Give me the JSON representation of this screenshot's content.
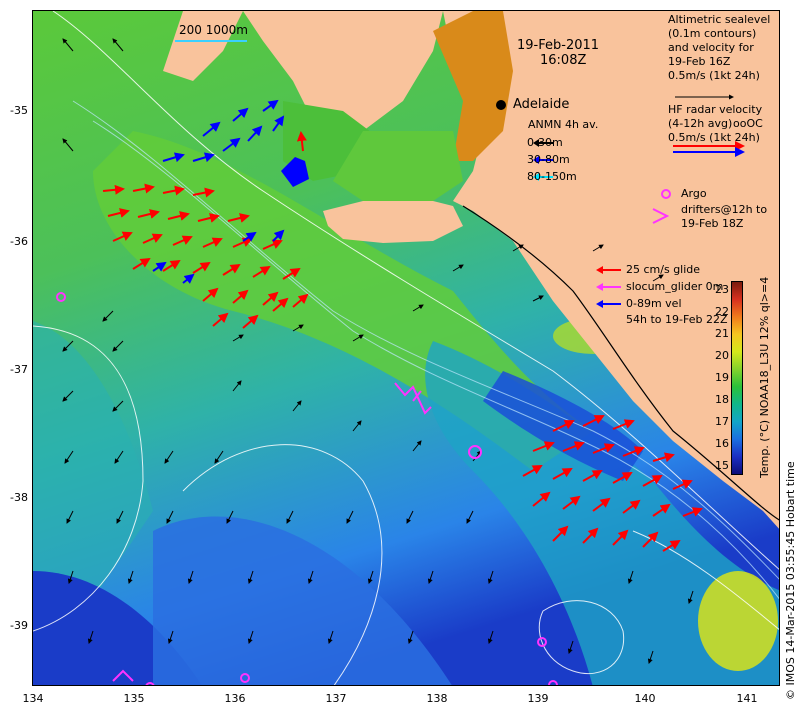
{
  "map": {
    "date": "19-Feb-2011",
    "time": "16:08Z",
    "scale_bar_label": "200  1000m",
    "place_label": "Adelaide",
    "lon_ticks": [
      "134",
      "135",
      "136",
      "137",
      "138",
      "139",
      "140",
      "141"
    ],
    "lat_ticks": [
      "-35",
      "-36",
      "-37",
      "-38",
      "-39"
    ]
  },
  "legend": {
    "altimetric": [
      "Altimetric sealevel",
      "(0.1m contours)",
      "and velocity for",
      "19-Feb 16Z",
      "0.5m/s (1kt 24h)"
    ],
    "hf_radar": [
      "HF radar velocity",
      "(4-12h avg)",
      "0.5m/s (1kt 24h)"
    ],
    "hf_radar_site": "ooOC",
    "anmn_title": "ANMN 4h av.",
    "anmn_items": [
      {
        "label": "0-30m",
        "color": "#000000"
      },
      {
        "label": "30-80m",
        "color": "#0000ff"
      },
      {
        "label": "80-150m",
        "color": "#00e5ff"
      }
    ],
    "argo_label": "Argo",
    "drifters": [
      "drifters@12h to",
      "19-Feb 18Z"
    ],
    "glider": [
      "25 cm/s glide",
      "slocum_glider 0m",
      "0-89m vel",
      "54h to 19-Feb 22Z"
    ]
  },
  "colorbar": {
    "label": "Temp. (°C) NOAA18_L3U 12% ql>=4",
    "ticks": [
      "23",
      "22",
      "21",
      "20",
      "19",
      "18",
      "17",
      "16",
      "15"
    ],
    "colors": [
      "#7a1b0c",
      "#d7301f",
      "#f07b1c",
      "#f5c620",
      "#d4e81a",
      "#84d22c",
      "#2bc13a",
      "#10b78a",
      "#12a5c7",
      "#1a6fe0",
      "#1b2fc4",
      "#0d0d78"
    ]
  },
  "credit": "© IMOS 14-Mar-2015 03:55:45 Hobart time",
  "colors": {
    "land": "#f9c39c",
    "sea_blue": "#2a7ff0",
    "sea_green": "#6ed23a",
    "deep_blue": "#1a3cc8",
    "arrow_red": "#ff0000",
    "argo_magenta": "#ff33ff"
  }
}
